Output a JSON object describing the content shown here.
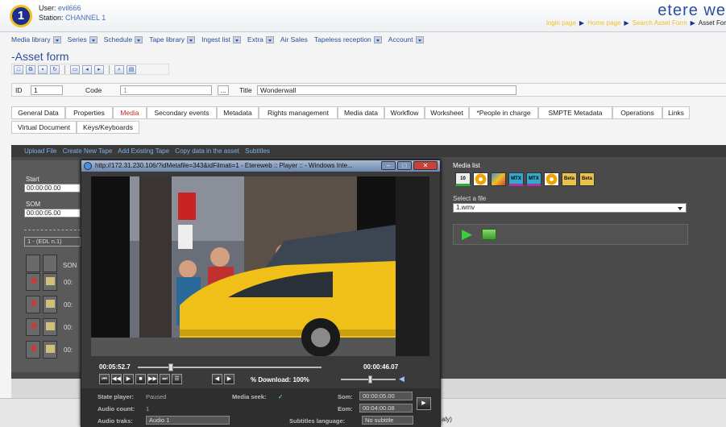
{
  "header": {
    "logo_text": "1",
    "user_label": "User:",
    "user_value": "evil666",
    "station_label": "Station:",
    "station_value": "CHANNEL 1",
    "brand": "etere we",
    "links": [
      "login page",
      "Home page",
      "Search Asset Form",
      "Asset For"
    ]
  },
  "menu": [
    "Media library",
    "Series",
    "Schedule",
    "Tape library",
    "Ingest list",
    "Extra",
    "Air Sales",
    "Tapeless reception",
    "Account"
  ],
  "form_title": "-Asset form",
  "id_row": {
    "id_label": "ID",
    "id_value": "1",
    "code_label": "Code",
    "code_value": "1",
    "code_btn": "...",
    "title_label": "Title",
    "title_value": "Wonderwall"
  },
  "tabs_row1": [
    "General Data",
    "Properties",
    "Media",
    "Secondary events",
    "Metadata",
    "Rights management",
    "Media data",
    "Workflow",
    "Worksheet",
    "*People in charge",
    "SMPTE Metadata",
    "Operations",
    "Links"
  ],
  "tabs_row2": [
    "Virtual Document",
    "Keys/Keyboards"
  ],
  "active_tab": "Media",
  "sublinks": [
    "Upload File",
    "Create New Tape",
    "Add Existing Tape",
    "Copy data in the asset",
    "Subtitles"
  ],
  "left": {
    "start_label": "Start",
    "start_value": "00:00:00.00",
    "som_label": "SOM",
    "som_value": "00:00:05.00",
    "edl_value": "1 - (EDL n.1)",
    "col_trunc": "SON",
    "row_trunc": "00:"
  },
  "media_list": {
    "title": "Media list",
    "icons": [
      "10",
      "dvd",
      "img",
      "MTX",
      "MTX",
      "dvd",
      "Beta",
      "Beta"
    ],
    "select_label": "Select a file",
    "select_value": "1.wmv"
  },
  "player": {
    "window_title": "http://172.31.230.106/?idMetafile=343&idFilmati=1 - Etereweb :: Player :: - Windows Inte...",
    "time_current": "00:05:52.7",
    "time_total": "00:00:46.07",
    "download": "% Download: 100%",
    "state_label": "State player:",
    "state_value": "Paused",
    "audio_count_label": "Audio count:",
    "audio_count_value": "1",
    "audio_tracks_label": "Audio traks:",
    "audio_tracks_value": "Audio 1",
    "media_seek_label": "Media seek:",
    "media_seek_value": "✓",
    "som_label": "Som:",
    "som_value": "00:00:05.00",
    "eom_label": "Eom:",
    "eom_value": "00:04:00.08",
    "subtitles_label": "Subtitles language:",
    "subtitles_value": "No subtitle",
    "seek_fraction": 0.18,
    "volume_fraction": 0.55
  },
  "status_text": "aly)"
}
